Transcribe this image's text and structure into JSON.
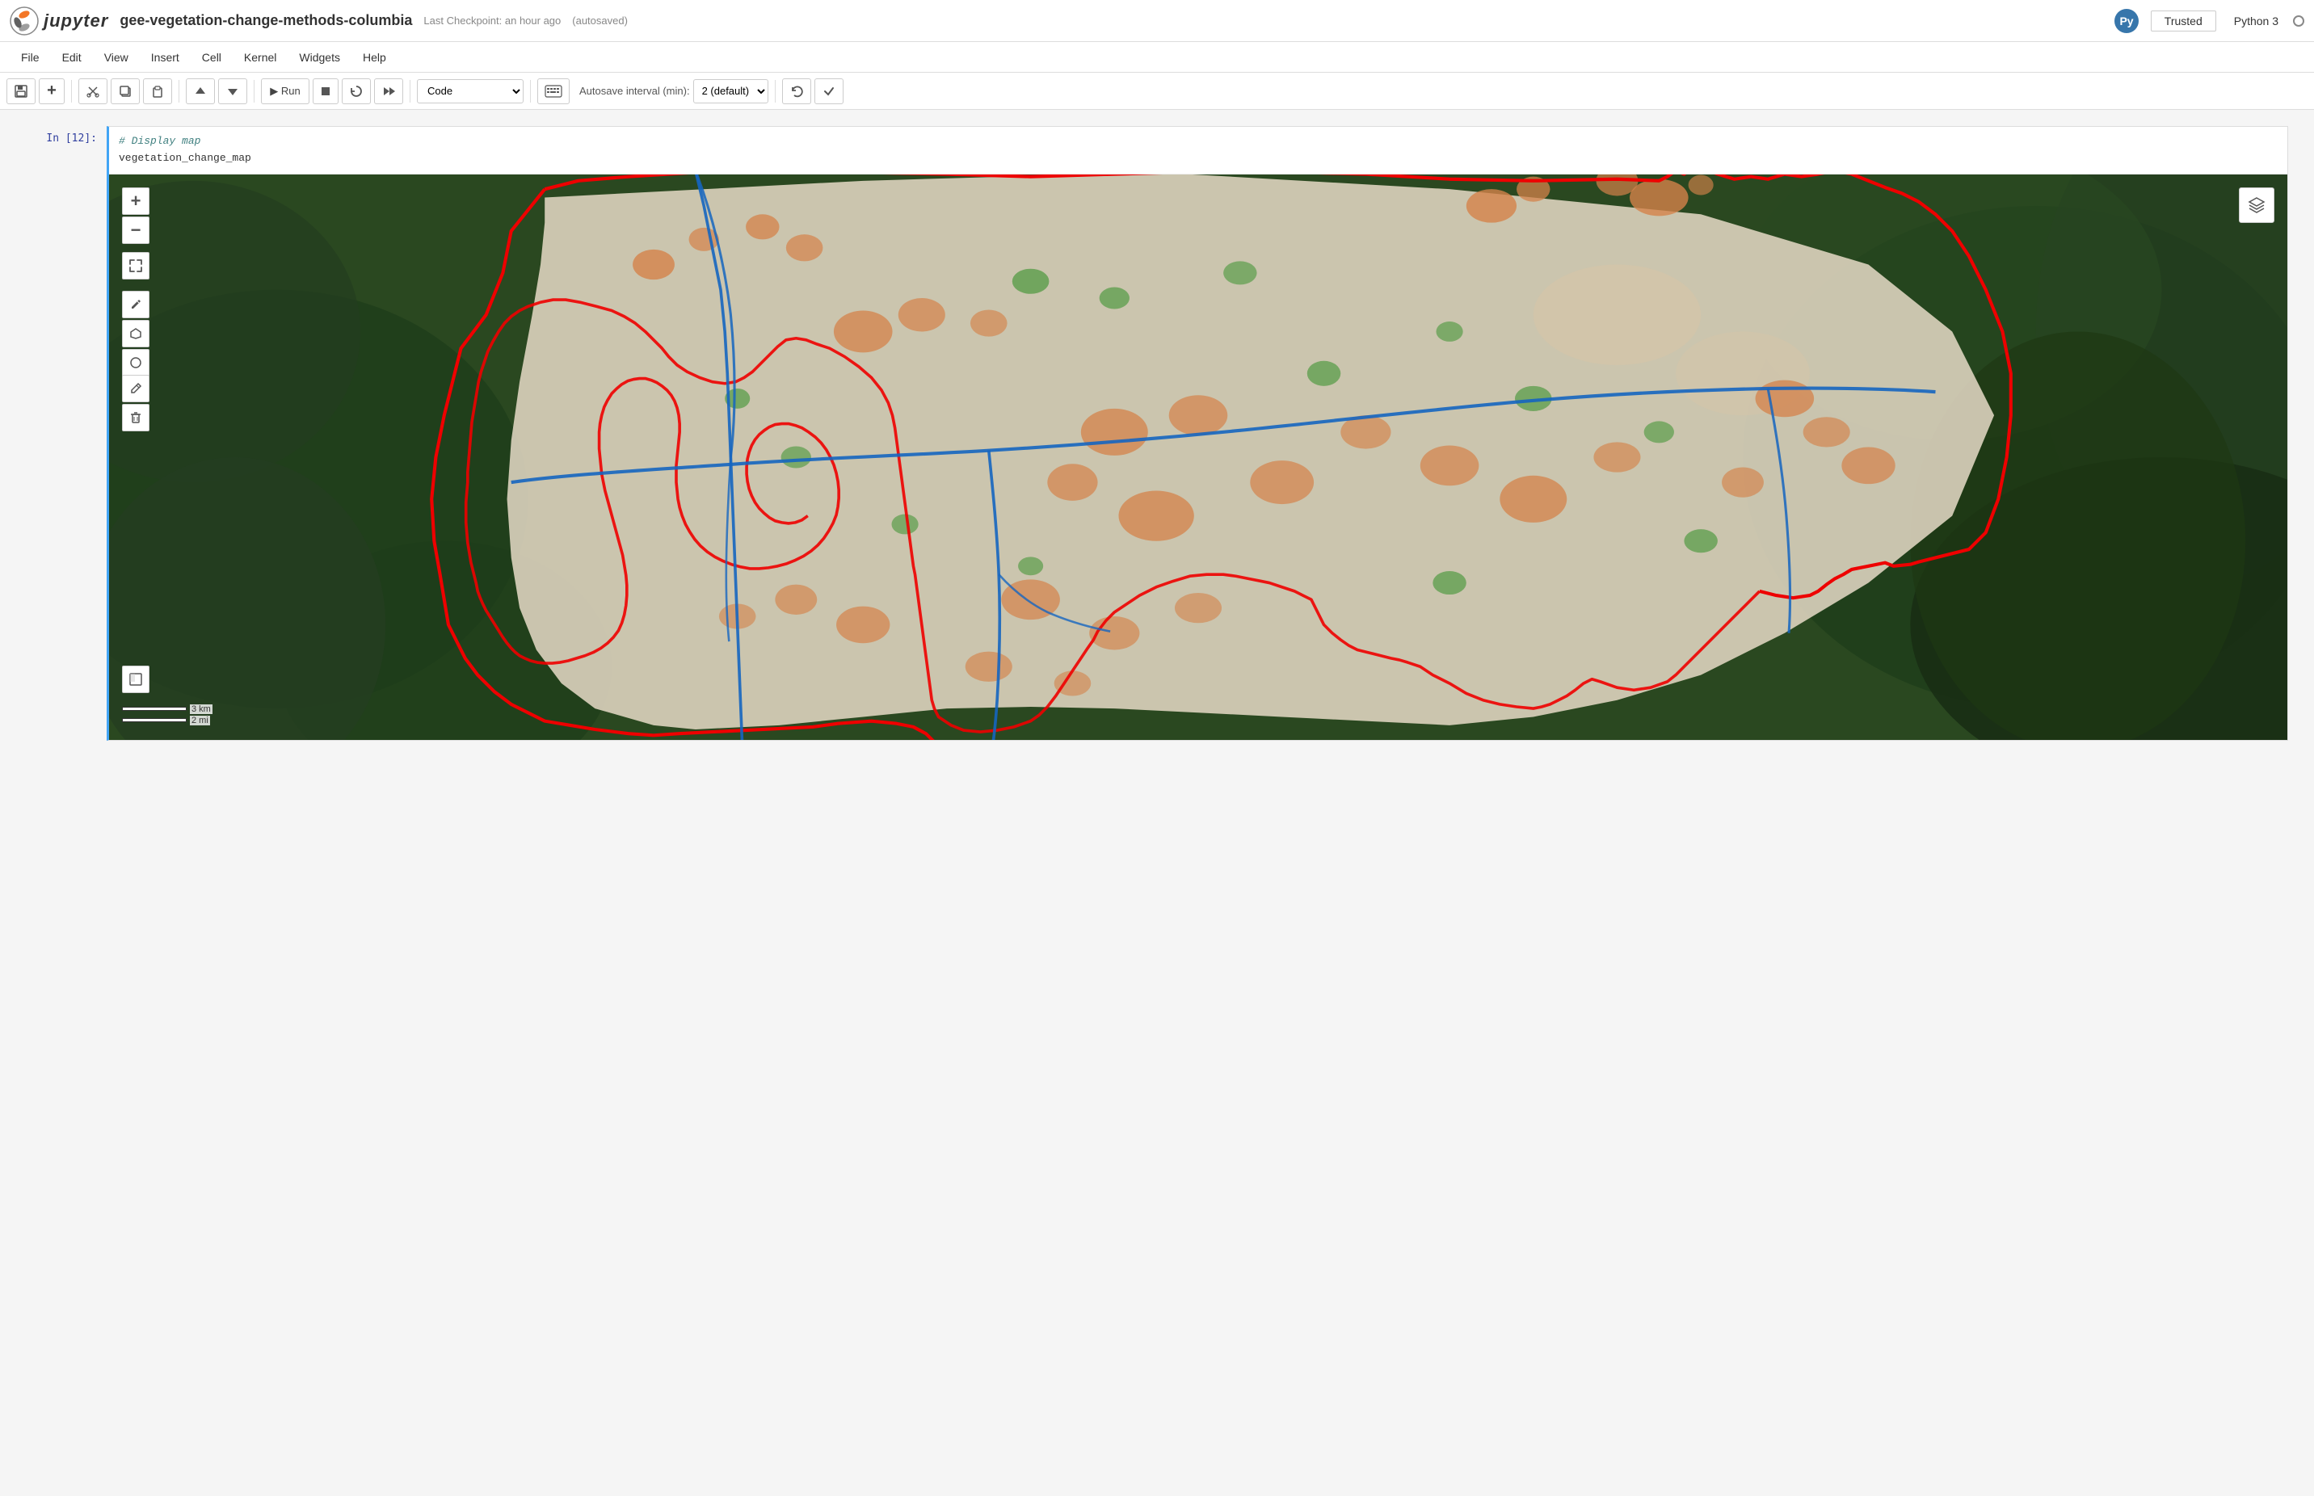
{
  "topbar": {
    "logo_text": "jupyter",
    "notebook_title": "gee-vegetation-change-methods-columbia",
    "checkpoint_text": "Last Checkpoint: an hour ago",
    "autosaved_text": "(autosaved)",
    "trusted_label": "Trusted",
    "python_label": "Python 3"
  },
  "menubar": {
    "items": [
      "File",
      "Edit",
      "View",
      "Insert",
      "Cell",
      "Kernel",
      "Widgets",
      "Help"
    ]
  },
  "toolbar": {
    "save_label": "💾",
    "add_label": "+",
    "cut_label": "✂",
    "copy_label": "⎘",
    "paste_label": "📋",
    "move_up_label": "↑",
    "move_down_label": "↓",
    "run_label": "▶ Run",
    "stop_label": "■",
    "restart_label": "↻",
    "restart_run_label": "⏭",
    "cell_type": "Code",
    "autosave_label": "Autosave interval (min):",
    "autosave_value": "2 (default)",
    "undo_label": "↩",
    "validate_label": "✓"
  },
  "cell": {
    "prompt": "In [12]:",
    "line1": "# Display map",
    "line2": "vegetation_change_map"
  },
  "map": {
    "zoom_in": "+",
    "zoom_out": "−",
    "fullscreen": "⛶",
    "draw_line": "✏",
    "draw_polygon": "⬠",
    "draw_circle": "○",
    "edit_btn": "✎",
    "delete_btn": "🗑",
    "layers_icon": "⊞",
    "scale_3km": "3 km",
    "scale_2mi": "2 mi"
  }
}
